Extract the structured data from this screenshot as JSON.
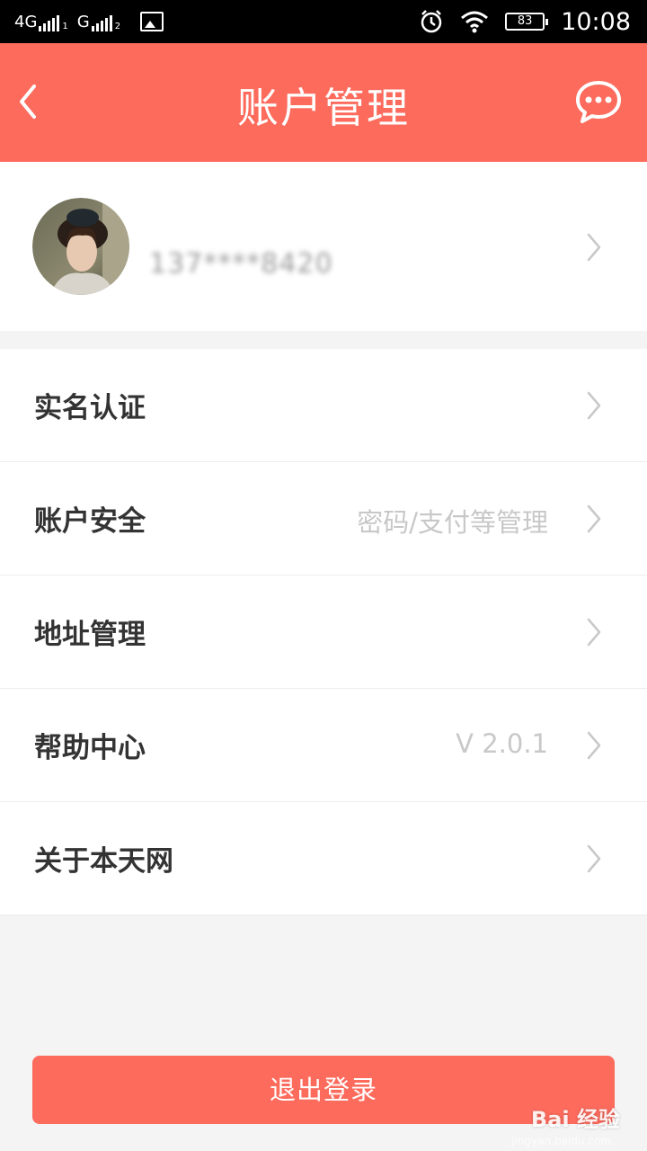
{
  "status_bar": {
    "signal1_label": "4G",
    "signal1_sub": "1",
    "signal2_label": "G",
    "signal2_sub": "2",
    "battery": "83",
    "time": "10:08"
  },
  "header": {
    "title": "账户管理",
    "back_icon": "chevron-left-icon",
    "message_icon": "chat-bubble-icon",
    "color": "#fd6b5d"
  },
  "profile": {
    "phone_masked": "137****8420"
  },
  "menu": [
    {
      "label": "实名认证",
      "sub": ""
    },
    {
      "label": "账户安全",
      "sub": "密码/支付等管理"
    },
    {
      "label": "地址管理",
      "sub": ""
    },
    {
      "label": "帮助中心",
      "sub": "V 2.0.1"
    },
    {
      "label": "关于本天网",
      "sub": ""
    }
  ],
  "logout_label": "退出登录",
  "watermark": {
    "text": "Bai 经验",
    "sub": "jingyan.baidu.com"
  }
}
